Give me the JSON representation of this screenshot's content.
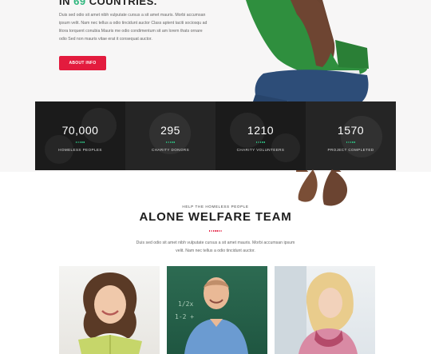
{
  "hero": {
    "heading_prefix": "IN ",
    "heading_number": "69",
    "heading_suffix": " COUNTRIES.",
    "description": "Duis sed odio sit amet nibh vulputate cursus a sit amet mauris. Morbi accumsan ipsum velit. Nam nec tellus a odio tincidunt auctor Class aptent taciti sociosqu ad litora torquent conubia Mauris me odio condimentum sit am lorem thats ornare odio Sed non mauris vitae erat it consequat auctor.",
    "button_label": "ABOUT INFO"
  },
  "stats": [
    {
      "value": "70,000",
      "label": "HOMELESS PEOPLES"
    },
    {
      "value": "295",
      "label": "CHARITY DONORS"
    },
    {
      "value": "1210",
      "label": "CHARITY VOLUNTEERS"
    },
    {
      "value": "1570",
      "label": "PROJECT COMPLETED"
    }
  ],
  "team": {
    "eyebrow": "HELP THE HOMELESS PEOPLE",
    "title": "ALONE WELFARE TEAM",
    "description": "Duis sed odio sit amet nibh vulputate cursus a sit amet mauris. Morbi accumsan ipsum velit. Nam nec tellus a odio tincidunt auctor."
  },
  "colors": {
    "accent_red": "#e31b3e",
    "accent_green": "#2eb67d",
    "stats_background": "#1b1b1b"
  }
}
